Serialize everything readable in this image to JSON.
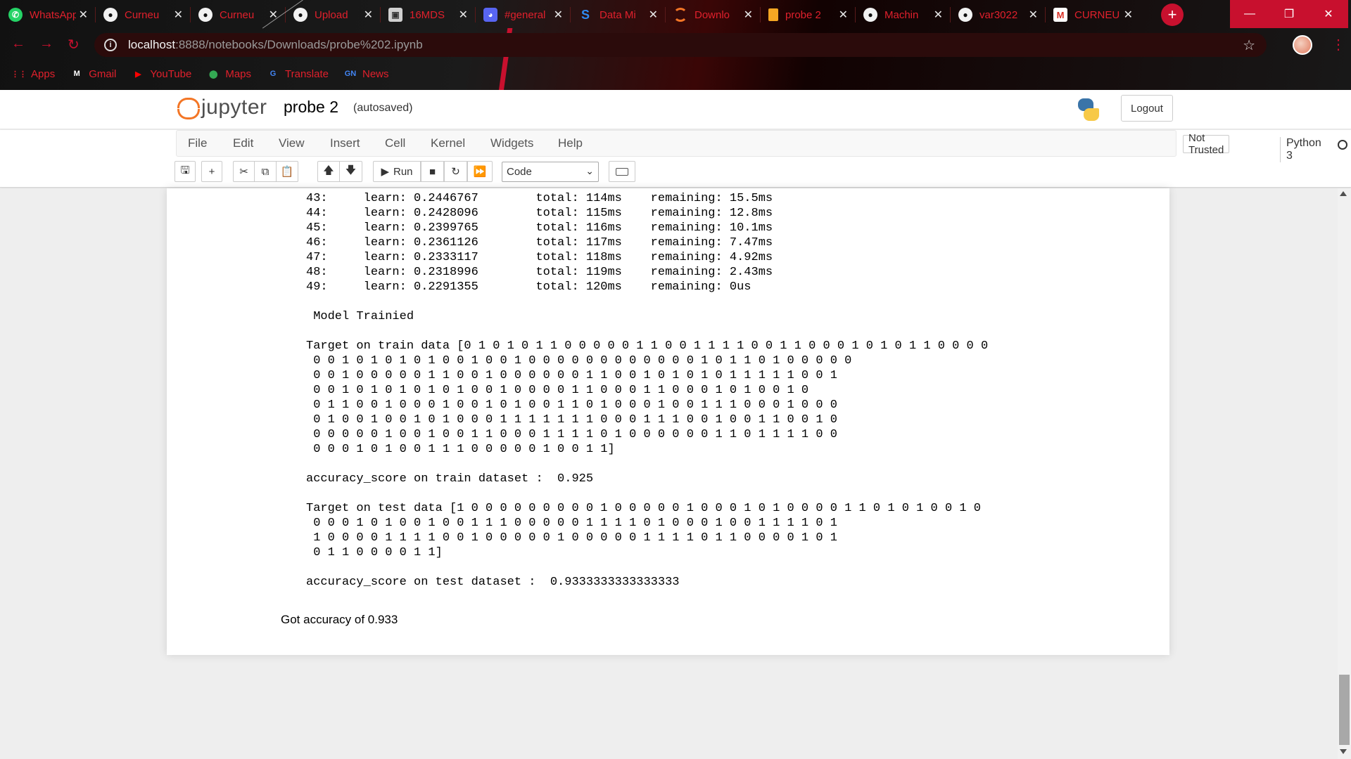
{
  "browser": {
    "tabs": [
      {
        "label": "WhatsApp",
        "icon": "whatsapp-icon",
        "glyph": "✆"
      },
      {
        "label": "Curneu",
        "icon": "github-icon",
        "glyph": "●"
      },
      {
        "label": "Curneu",
        "icon": "github-icon",
        "glyph": "●"
      },
      {
        "label": "Upload",
        "icon": "github-icon",
        "glyph": "●"
      },
      {
        "label": "16MDS",
        "icon": "image-icon",
        "glyph": "▣"
      },
      {
        "label": "#general",
        "icon": "discord-icon",
        "glyph": "◕"
      },
      {
        "label": "Data Mi",
        "icon": "s-icon",
        "glyph": "S"
      },
      {
        "label": "Downlo",
        "icon": "jupyter-icon",
        "glyph": ""
      },
      {
        "label": "probe 2",
        "icon": "document-icon",
        "glyph": ""
      },
      {
        "label": "Machin",
        "icon": "github-icon",
        "glyph": "●"
      },
      {
        "label": "var3022",
        "icon": "github-icon",
        "glyph": "●"
      },
      {
        "label": "CURNEU",
        "icon": "gmail-icon",
        "glyph": "M"
      }
    ],
    "tab_close_glyph": "✕",
    "new_tab_glyph": "+",
    "window_controls": {
      "minimize": "—",
      "maximize": "❐",
      "close": "✕"
    },
    "nav": {
      "back": "←",
      "forward": "→",
      "reload": "↻",
      "info": "i",
      "star": "☆",
      "menu": "⋮"
    },
    "url_host": "localhost",
    "url_path": ":8888/notebooks/Downloads/probe%202.ipynb",
    "bookmarks": [
      {
        "label": "Apps",
        "icon": "apps-grid-icon",
        "glyph": "⋮⋮",
        "color": "#e0202c"
      },
      {
        "label": "Gmail",
        "icon": "gmail-icon",
        "glyph": "M",
        "color": "#ffffff"
      },
      {
        "label": "YouTube",
        "icon": "youtube-icon",
        "glyph": "▶",
        "color": "#ff0000"
      },
      {
        "label": "Maps",
        "icon": "maps-pin-icon",
        "glyph": "⬤",
        "color": "#34a853"
      },
      {
        "label": "Translate",
        "icon": "translate-icon",
        "glyph": "G",
        "color": "#4285f4"
      },
      {
        "label": "News",
        "icon": "news-icon",
        "glyph": "GN",
        "color": "#4285f4"
      }
    ]
  },
  "jupyter": {
    "logo_text": "jupyter",
    "notebook_name": "probe 2",
    "autosave_status": "(autosaved)",
    "logout_label": "Logout",
    "menu": [
      "File",
      "Edit",
      "View",
      "Insert",
      "Cell",
      "Kernel",
      "Widgets",
      "Help"
    ],
    "trust_status": "Not Trusted",
    "kernel_name": "Python 3",
    "toolbar": {
      "run_label": "Run",
      "cell_type": "Code",
      "icons": {
        "save": "🖫",
        "add": "+",
        "cut": "✂",
        "copy": "⧉",
        "paste": "📋",
        "up": "🡅",
        "down": "🡇",
        "run": "▶",
        "stop": "■",
        "restart": "↻",
        "run_all": "⏩",
        "chevron": "⌄"
      }
    }
  },
  "output": {
    "lines": [
      "43:     learn: 0.2446767        total: 114ms    remaining: 15.5ms",
      "44:     learn: 0.2428096        total: 115ms    remaining: 12.8ms",
      "45:     learn: 0.2399765        total: 116ms    remaining: 10.1ms",
      "46:     learn: 0.2361126        total: 117ms    remaining: 7.47ms",
      "47:     learn: 0.2333117        total: 118ms    remaining: 4.92ms",
      "48:     learn: 0.2318996        total: 119ms    remaining: 2.43ms",
      "49:     learn: 0.2291355        total: 120ms    remaining: 0us",
      "",
      " Model Trainied",
      "",
      "Target on train data [0 1 0 1 0 1 1 0 0 0 0 0 1 1 0 0 1 1 1 1 0 0 1 1 0 0 0 1 0 1 0 1 1 0 0 0 0",
      " 0 0 1 0 1 0 1 0 1 0 0 1 0 0 1 0 0 0 0 0 0 0 0 0 0 0 0 1 0 1 1 0 1 0 0 0 0 0",
      " 0 0 1 0 0 0 0 0 1 1 0 0 1 0 0 0 0 0 0 1 1 0 0 1 0 1 0 1 0 1 1 1 1 1 0 0 1",
      " 0 0 1 0 1 0 1 0 1 0 1 0 0 1 0 0 0 0 1 1 0 0 0 1 1 0 0 0 1 0 1 0 0 1 0",
      " 0 1 1 0 0 1 0 0 0 1 0 0 1 0 1 0 0 1 1 0 1 0 0 0 1 0 0 1 1 1 0 0 0 1 0 0 0",
      " 0 1 0 0 1 0 0 1 0 1 0 0 0 1 1 1 1 1 1 1 0 0 0 1 1 1 0 0 1 0 0 1 1 0 0 1 0",
      " 0 0 0 0 0 1 0 0 1 0 0 1 1 0 0 0 1 1 1 1 0 1 0 0 0 0 0 0 1 1 0 1 1 1 1 0 0",
      " 0 0 0 1 0 1 0 0 1 1 1 0 0 0 0 0 1 0 0 1 1]",
      "",
      "accuracy_score on train dataset :  0.925",
      "",
      "Target on test data [1 0 0 0 0 0 0 0 0 0 1 0 0 0 0 0 1 0 0 0 1 0 1 0 0 0 0 1 1 0 1 0 1 0 0 1 0",
      " 0 0 0 1 0 1 0 0 1 0 0 1 1 1 0 0 0 0 0 1 1 1 1 0 1 0 0 0 1 0 0 1 1 1 1 0 1",
      " 1 0 0 0 0 1 1 1 1 0 0 1 0 0 0 0 0 1 0 0 0 0 0 1 1 1 1 0 1 1 0 0 0 0 1 0 1",
      " 0 1 1 0 0 0 0 1 1]",
      "",
      "accuracy_score on test dataset :  0.9333333333333333"
    ],
    "final_text": "Got accuracy of 0.933"
  },
  "colors": {
    "brand_red": "#c8102e",
    "jupyter_orange": "#f37626",
    "tab_text": "#e0202c"
  }
}
